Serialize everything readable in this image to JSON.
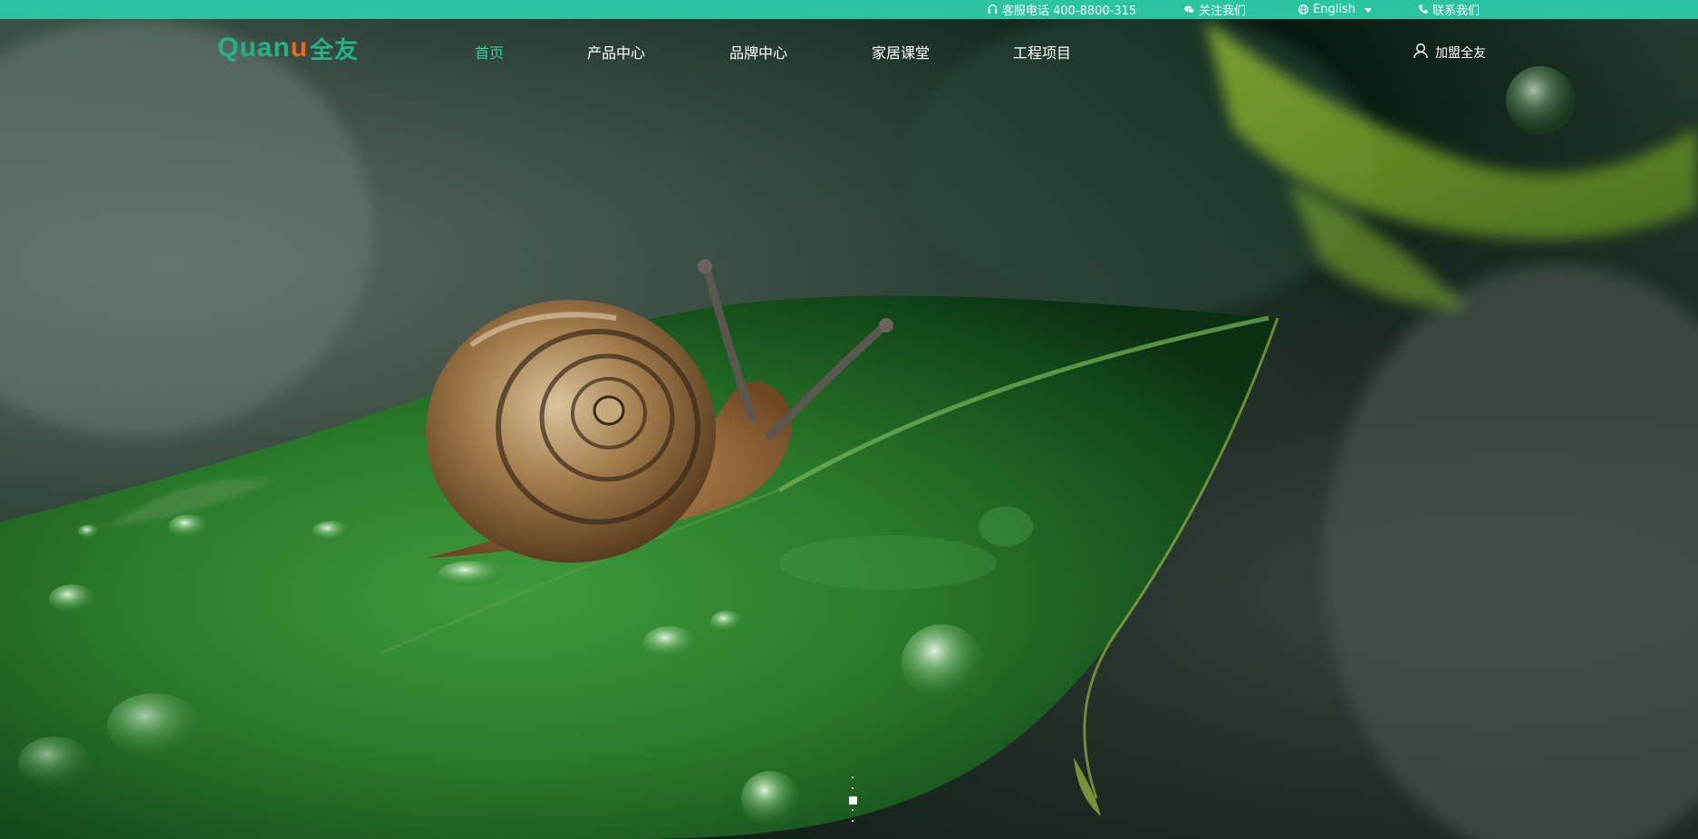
{
  "topbar": {
    "hotline_label": "客服电话 400-8800-315",
    "follow_label": "关注我们",
    "language_label": "English",
    "contact_label": "联系我们"
  },
  "header": {
    "logo_latin": "Quan",
    "logo_latin_u": "u",
    "logo_cn": "全友",
    "nav": [
      {
        "label": "首页",
        "active": true
      },
      {
        "label": "产品中心",
        "active": false
      },
      {
        "label": "品牌中心",
        "active": false
      },
      {
        "label": "家居课堂",
        "active": false
      },
      {
        "label": "工程项目",
        "active": false
      }
    ],
    "join_label": "加盟全友"
  },
  "hero": {
    "icons": [
      "headset-icon",
      "wechat-icon",
      "globe-icon",
      "phone-icon",
      "user-icon"
    ]
  },
  "slider": {
    "total_slides": 5,
    "active_index": 2
  },
  "colors": {
    "accent": "#2bc4a0",
    "nav_active": "#2bd1a6",
    "logo_green": "#22b38b",
    "logo_orange": "#e96a1e"
  }
}
